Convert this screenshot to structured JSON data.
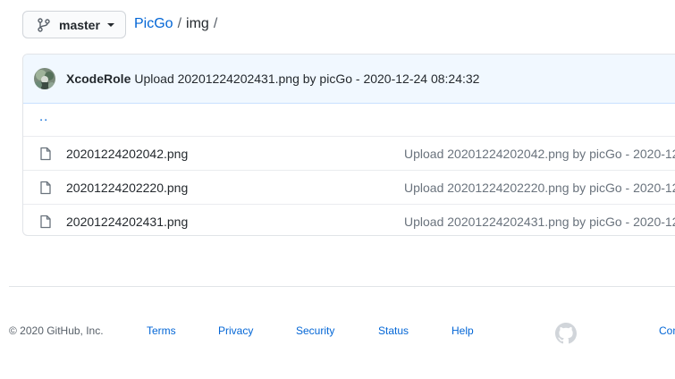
{
  "branch": {
    "label": "master",
    "icon": "git-branch-icon"
  },
  "breadcrumb": {
    "repo": "PicGo",
    "separator": "/",
    "dir": "img",
    "trailing": "/"
  },
  "commit": {
    "author": "XcodeRole",
    "message": "Upload 20201224202431.png by picGo - 2020-12-24 08:24:32"
  },
  "parent_dir": "..",
  "files": [
    {
      "name": "20201224202042.png",
      "commit": "Upload 20201224202042.png by picGo - 2020-12",
      "icon": "file-icon"
    },
    {
      "name": "20201224202220.png",
      "commit": "Upload 20201224202220.png by picGo - 2020-12",
      "icon": "file-icon"
    },
    {
      "name": "20201224202431.png",
      "commit": "Upload 20201224202431.png by picGo - 2020-12",
      "icon": "file-icon"
    }
  ],
  "footer": {
    "copyright": "© 2020 GitHub, Inc.",
    "links": [
      "Terms",
      "Privacy",
      "Security",
      "Status",
      "Help"
    ],
    "right_link": "Con",
    "logo": "github-mark-icon"
  },
  "colors": {
    "link": "#0366d6",
    "text": "#24292e",
    "muted": "#6a737d",
    "commit_bar_bg": "#f1f8ff",
    "border": "#e1e4e8"
  }
}
